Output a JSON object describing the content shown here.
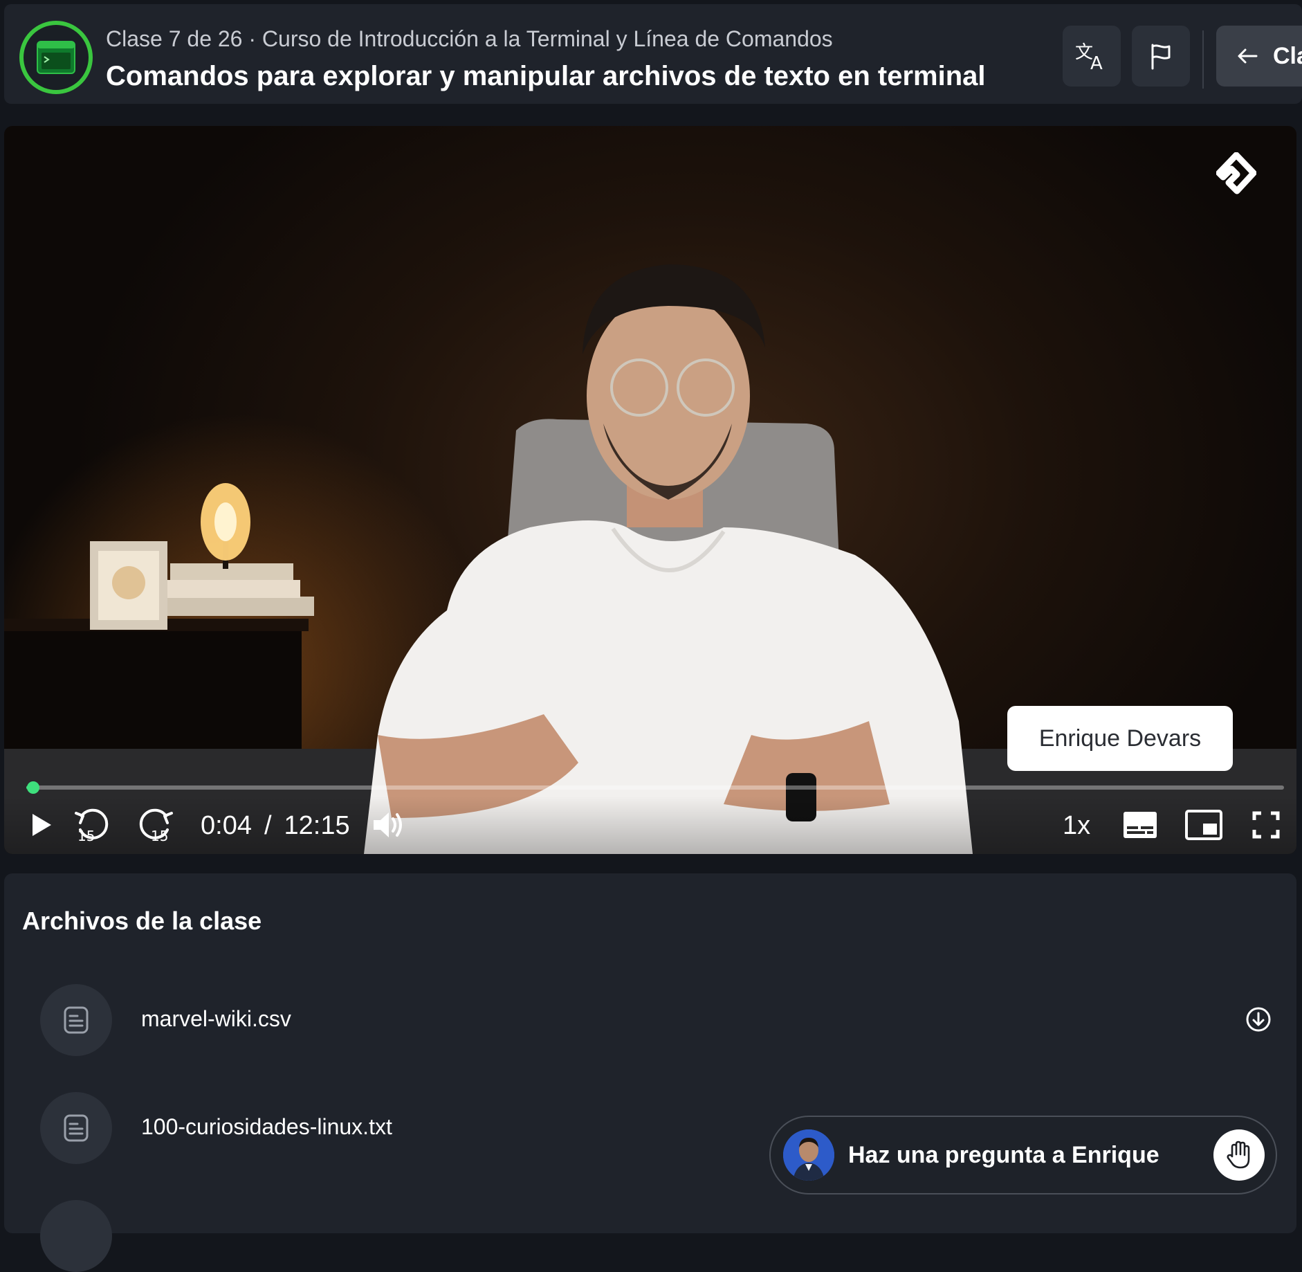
{
  "header": {
    "course_meta": "Clase 7 de 26 · Curso de Introducción a la Terminal y Línea de Comandos",
    "class_title": "Comandos para explorar y manipular archivos de texto en terminal",
    "translate_icon": "translate-icon",
    "report_icon": "flag-icon",
    "back_label": "Cla",
    "accent_color": "#3ac63f"
  },
  "video": {
    "presenter_name": "Enrique Devars",
    "current_time": "0:04",
    "time_separator": "/",
    "duration": "12:15",
    "progress_fraction": 0.0055,
    "speed": "1x",
    "rewind_seconds": "15",
    "forward_seconds": "15",
    "progress_color": "#3ee07d"
  },
  "files": {
    "title": "Archivos de la clase",
    "items": [
      {
        "name": "marvel-wiki.csv",
        "icon": "document-icon",
        "action_icon": "download-icon"
      },
      {
        "name": "100-curiosidades-linux.txt",
        "icon": "document-icon"
      }
    ]
  },
  "ask": {
    "label": "Haz una pregunta a Enrique",
    "icon": "raised-hand-icon"
  }
}
